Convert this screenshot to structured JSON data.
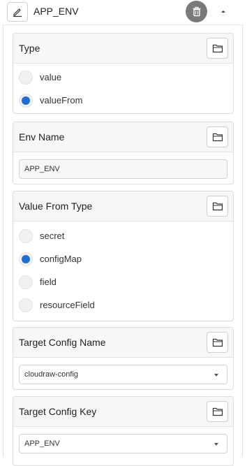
{
  "header": {
    "title": "APP_ENV"
  },
  "colors": {
    "accent": "#1f6fd1",
    "trash_bg": "#7a7a7a"
  },
  "type_section": {
    "title": "Type",
    "options": [
      {
        "label": "value",
        "checked": false
      },
      {
        "label": "valueFrom",
        "checked": true
      }
    ]
  },
  "env_name_section": {
    "title": "Env Name",
    "value": "APP_ENV"
  },
  "value_from_type_section": {
    "title": "Value From Type",
    "options": [
      {
        "label": "secret",
        "checked": false
      },
      {
        "label": "configMap",
        "checked": true
      },
      {
        "label": "field",
        "checked": false
      },
      {
        "label": "resourceField",
        "checked": false
      }
    ]
  },
  "target_config_name_section": {
    "title": "Target Config Name",
    "value": "cloudraw-config"
  },
  "target_config_key_section": {
    "title": "Target Config Key",
    "value": "APP_ENV"
  }
}
